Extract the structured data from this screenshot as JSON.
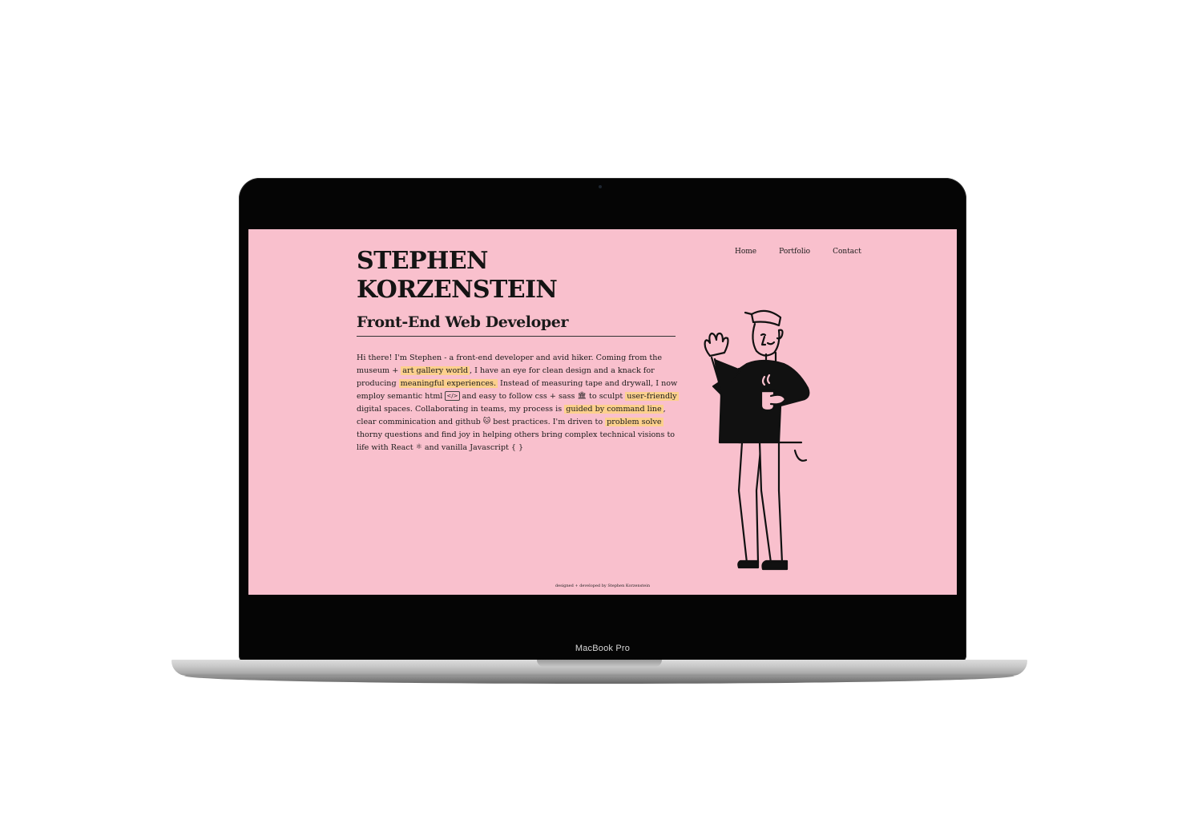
{
  "device": {
    "label": "MacBook Pro"
  },
  "site": {
    "title_line1": "STEPHEN",
    "title_line2": "KORZENSTEIN",
    "subtitle": "Front-End Web Developer",
    "nav": [
      {
        "label": "Home"
      },
      {
        "label": "Portfolio"
      },
      {
        "label": "Contact"
      }
    ],
    "bio": {
      "p1": "Hi there! I'm Stephen - a front-end developer and avid hiker. Coming from the museum + ",
      "hl1": "art gallery world",
      "p2": ", I have an eye for clean design and a knack for producing ",
      "hl2": "meaningful experiences.",
      "p3": " Instead of measuring tape and drywall, I now employ semantic html ",
      "emoji_html": "</>",
      "p4": " and easy to follow css + sass ",
      "emoji_sass": "🏛",
      "p5": " to sculpt ",
      "hl3": "user-friendly",
      "p6": " digital spaces. Collaborating in teams, my process is ",
      "hl4": "guided by command line",
      "p7": ", clear comminication and github ",
      "emoji_github": "🐱",
      "p8": " best practices. I'm driven to ",
      "hl5": "problem solve",
      "p9": " thorny questions and find joy in helping others bring complex technical visions to life with React ",
      "emoji_react": "⚛",
      "p10": " and vanilla Javascript { }"
    },
    "footer": "designed + developed by Stephen Korzenstein"
  },
  "colors": {
    "page_bg": "#f9c0cd",
    "highlight": "#fcd08d",
    "text": "#141414",
    "bezel": "#050505"
  },
  "icons": {
    "illustration": "waving-developer-illustration"
  }
}
